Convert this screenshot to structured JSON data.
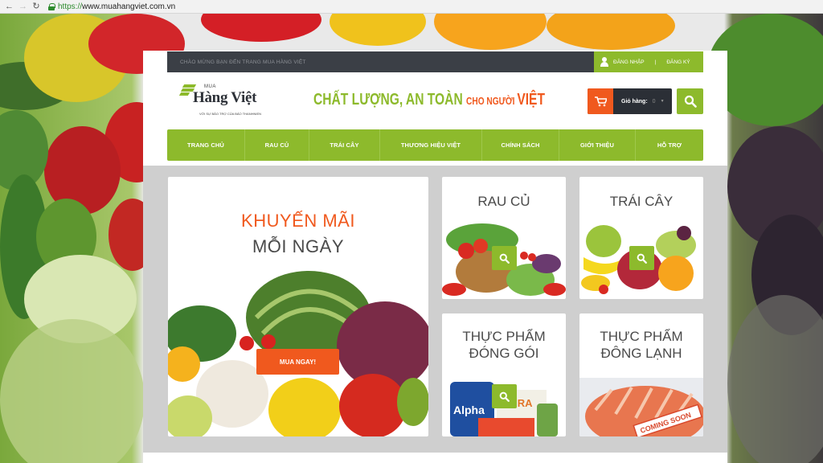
{
  "browser": {
    "url_scheme": "https://",
    "url_host": "www.muahangviet.com.vn",
    "back_glyph": "←",
    "forward_glyph": "→",
    "reload_glyph": "↻"
  },
  "topbar": {
    "welcome": "CHÀO MỪNG BẠN ĐẾN TRANG MUA HÀNG VIỆT",
    "login": "ĐĂNG NHẬP",
    "separator": "|",
    "register": "ĐĂNG KÝ"
  },
  "logo": {
    "mua": "MUA",
    "name": "Hàng Việt",
    "sub": "VỚI SỰ BẢO TRỢ CỦA BÁO THANHNIEN"
  },
  "slogan": {
    "main": "CHẤT LƯỢNG, AN TOÀN ",
    "small": "CHO NGƯỜI ",
    "viet": "VIỆT"
  },
  "cart": {
    "label": "Giỏ hàng:",
    "count": "0"
  },
  "nav": {
    "items": [
      "TRANG CHỦ",
      "RAU CỦ",
      "TRÁI CÂY",
      "THƯƠNG HIỆU VIỆT",
      "CHÍNH SÁCH",
      "GIỚI THIỆU",
      "HỖ TRỢ"
    ]
  },
  "promo": {
    "title_line1": "KHUYẾN MÃI",
    "title_line2": "MỖI NGÀY",
    "button": "MUA NGAY!"
  },
  "categories": {
    "rau_cu": {
      "title": "RAU CỦ"
    },
    "trai_cay": {
      "title": "TRÁI CÂY"
    },
    "dong_goi": {
      "title_line1": "THỰC PHẨM",
      "title_line2": "ĐÓNG GÓI",
      "pkg_text": "Alpha",
      "box_text": "HURA"
    },
    "dong_lanh": {
      "title_line1": "THỰC PHẨM",
      "title_line2": "ĐÔNG LẠNH",
      "ribbon": "COMING SOON"
    }
  },
  "colors": {
    "brand_green": "#8dba2c",
    "accent_orange": "#f0591e",
    "dark": "#3b3f46"
  }
}
